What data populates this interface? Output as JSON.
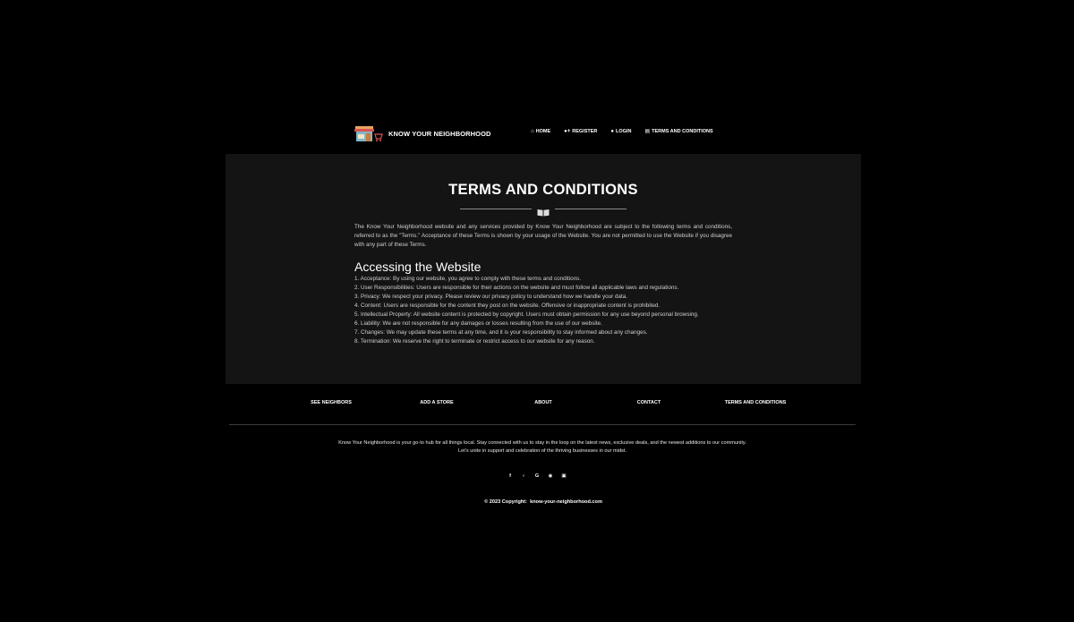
{
  "nav": {
    "brand": "KNOW YOUR NEIGHBORHOOD",
    "links": [
      {
        "label": "HOME",
        "icon": "home-icon"
      },
      {
        "label": "REGISTER",
        "icon": "user-plus-icon"
      },
      {
        "label": "LOGIN",
        "icon": "user-icon"
      },
      {
        "label": "TERMS AND CONDITIONS",
        "icon": "document-icon"
      }
    ]
  },
  "main": {
    "title": "TERMS AND CONDITIONS",
    "intro": "The Know Your Neighborhood website and any services provided by Know Your Neighborhood are subject to the following terms and conditions, referred to as the \"Terms.\" Acceptance of these Terms is shown by your usage of the Website. You are not permitted to use the Website if you disagree with any part of these Terms.",
    "section_heading": "Accessing the Website",
    "rules": [
      "1. Acceptance: By using our website, you agree to comply with these terms and conditions.",
      "2. User Responsibilities: Users are responsible for their actions on the website and must follow all applicable laws and regulations.",
      "3. Privacy: We respect your privacy. Please review our privacy policy to understand how we handle your data.",
      "4. Content: Users are responsible for the content they post on the website. Offensive or inappropriate content is prohibited.",
      "5. Intellectual Property: All website content is protected by copyright. Users must obtain permission for any use beyond personal browsing.",
      "6. Liability: We are not responsible for any damages or losses resulting from the use of our website.",
      "7. Changes: We may update these terms at any time, and it is your responsibility to stay informed about any changes.",
      "8. Termination: We reserve the right to terminate or restrict access to our website for any reason."
    ]
  },
  "footer": {
    "links": [
      "SEE NEIGHBORS",
      "ADD A STORE",
      "ABOUT",
      "CONTACT",
      "TERMS AND CONDITIONS"
    ],
    "about": "Know Your Neighborhood is your go-to hub for all things local. Stay connected with us to stay in the loop on the latest news, exclusive deals, and the newest additions to our community. Let's unite in support and celebration of the thriving businesses in our midst.",
    "social": [
      "facebook-icon",
      "twitter-icon",
      "google-icon",
      "instagram-icon",
      "linkedin-icon"
    ],
    "copyright_prefix": "© 2023 Copyright:",
    "copyright_site": "know-your-neighborhood.com"
  }
}
